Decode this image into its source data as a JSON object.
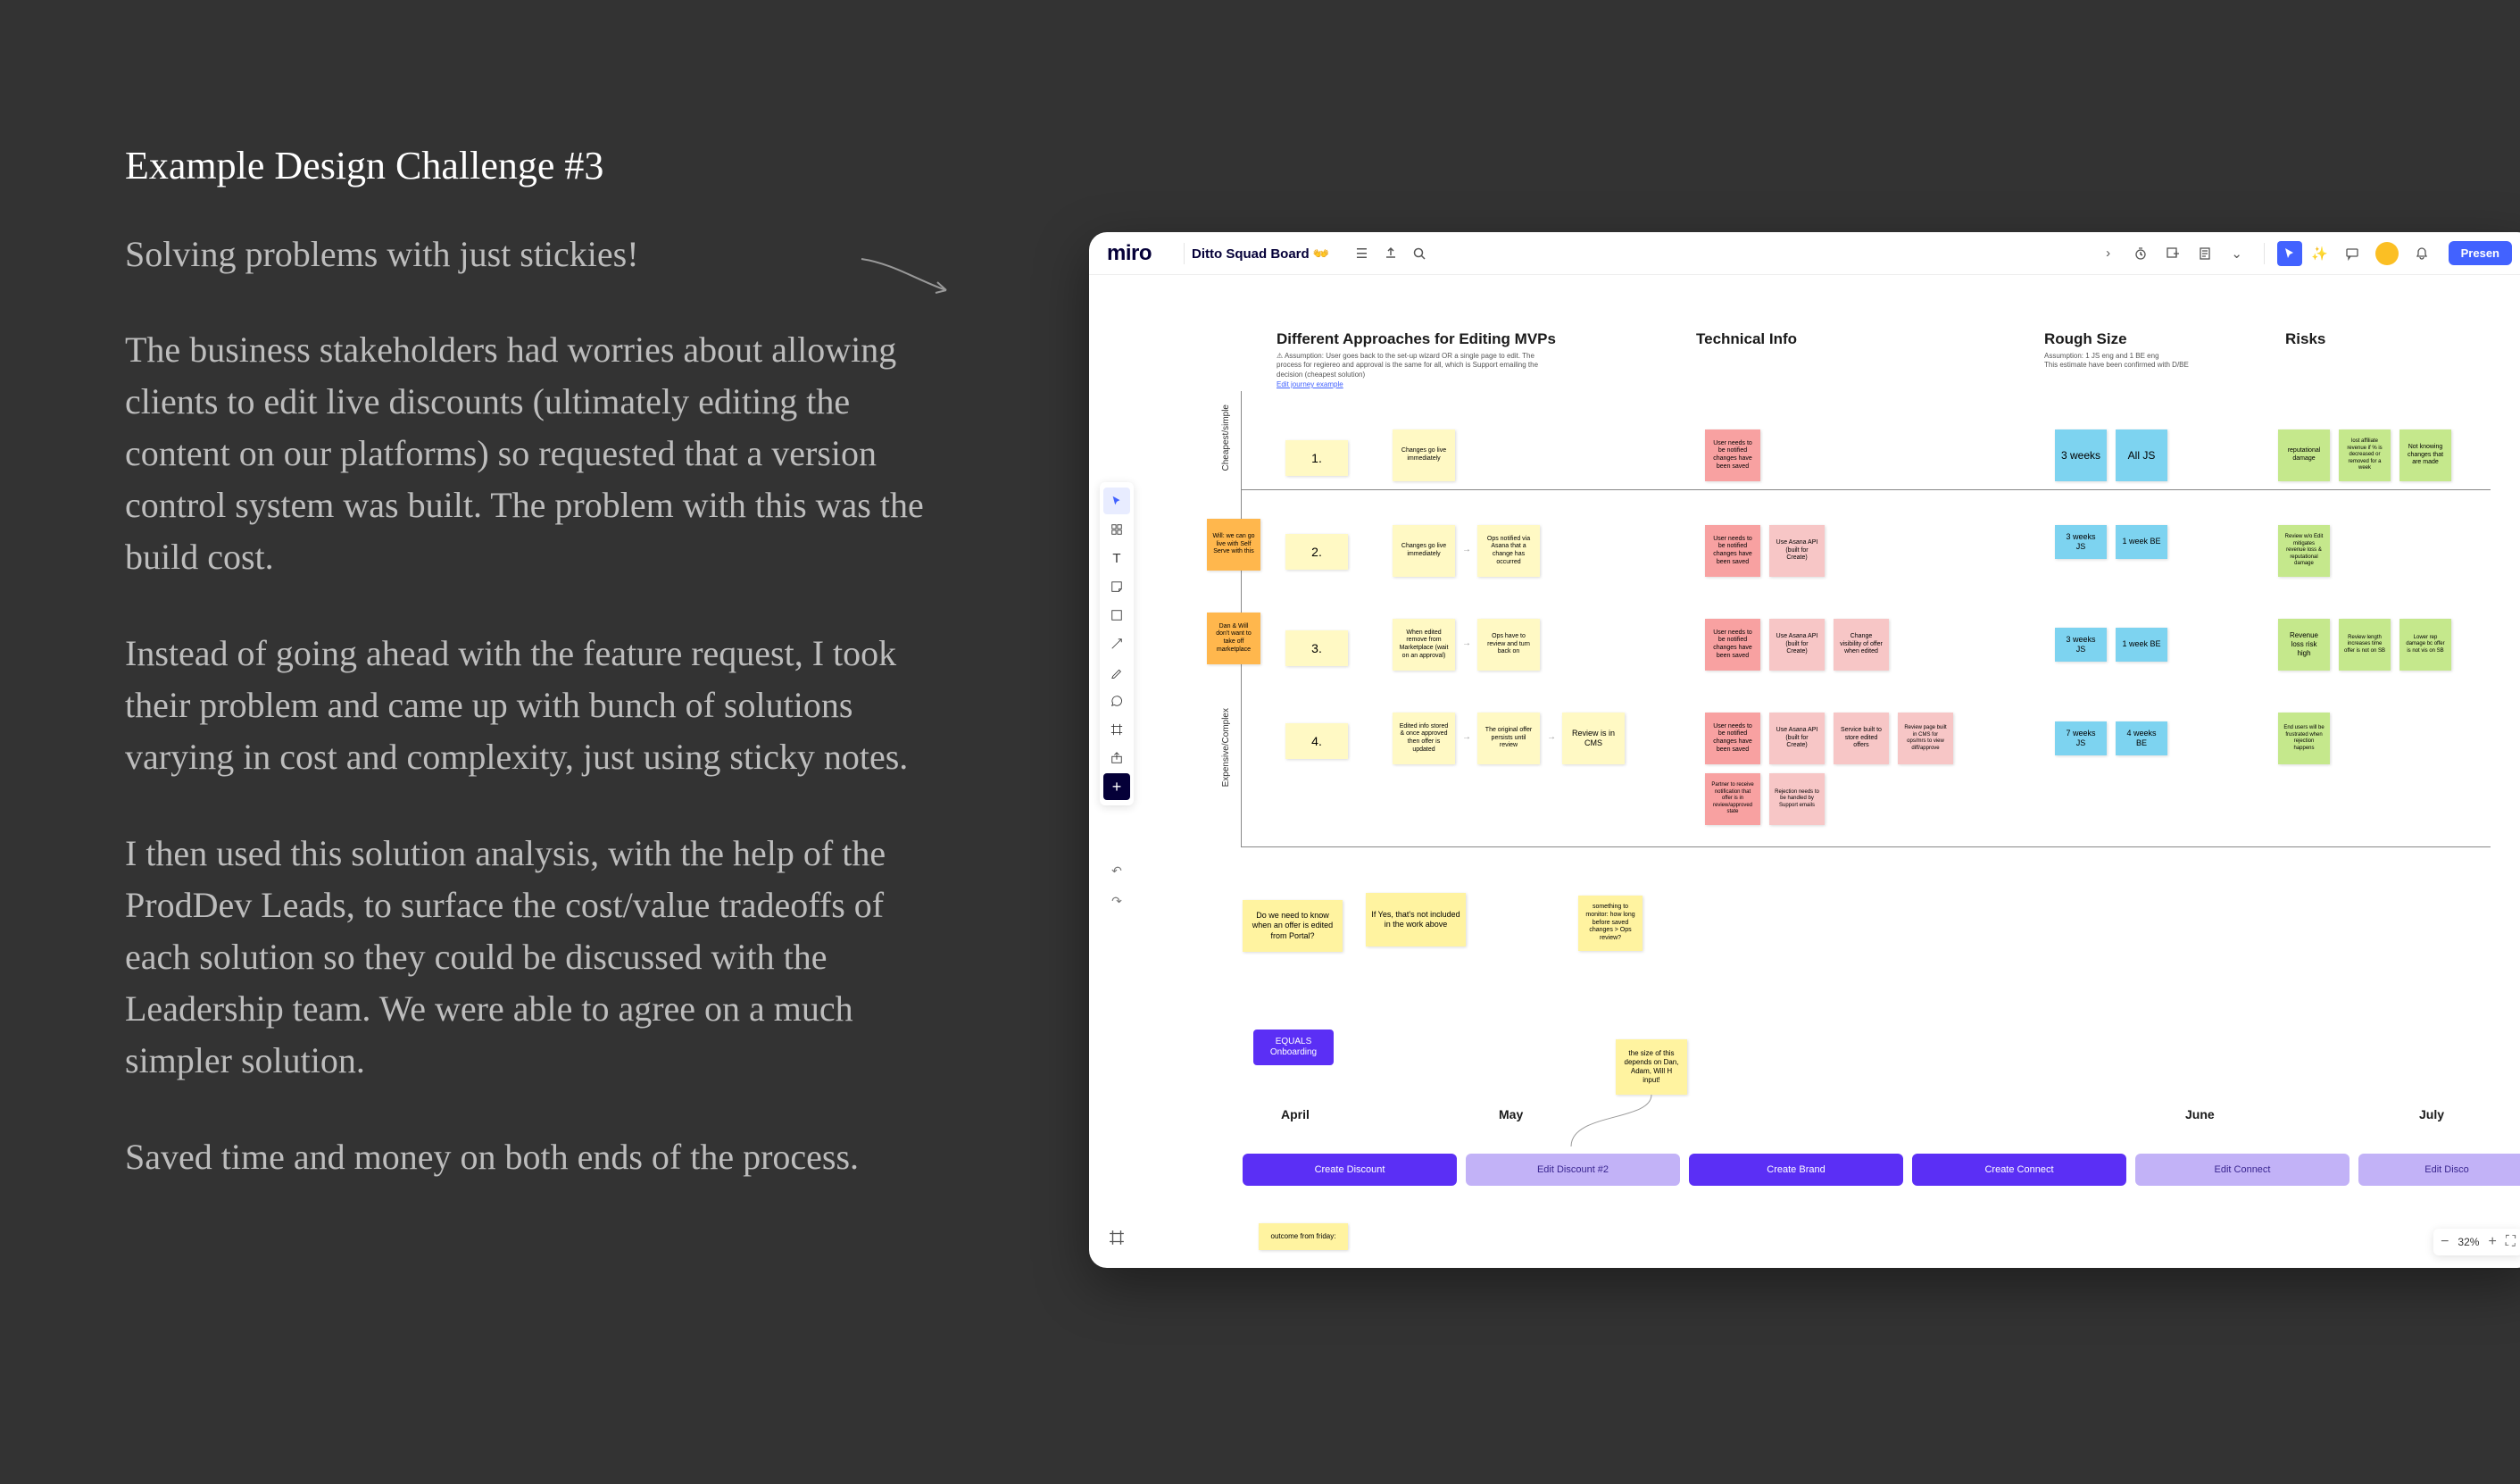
{
  "left": {
    "title": "Example Design Challenge #3",
    "subtitle": "Solving problems with just stickies!",
    "p1": "The business stakeholders had worries about allowing clients to edit live discounts (ultimately editing the content on our platforms) so requested that a version control system was built. The problem with this was the build cost.",
    "p2": "Instead of going ahead with the feature request, I took their problem and came up with bunch of solutions varying in cost and complexity, just using sticky notes.",
    "p3": "I then used this solution analysis, with the help of the ProdDev Leads, to surface the cost/value tradeoffs of each solution so they could be discussed with the Leadership team. We were able to agree on a much simpler solution.",
    "p4": "Saved time and money on both ends of the process."
  },
  "miro": {
    "logo": "miro",
    "board_title": "Ditto Squad Board 👐",
    "present": "Presen",
    "zoom_level": "32%",
    "headings": {
      "approaches": "Different Approaches for Editing MVPs",
      "tech": "Technical Info",
      "size": "Rough Size",
      "risks": "Risks"
    },
    "subnotes": {
      "assumption": "⚠ Assumption: User goes back to the set-up wizard OR a single page to edit. The process for regiereo and approval is the same for all, which is Support emailing the decision (cheapest solution)",
      "link": "Edit journey example",
      "size_note1": "Assumption: 1 JS eng and 1 BE eng",
      "size_note2": "This estimate have been confirmed with D/BE"
    },
    "axis": {
      "top": "Cheapest/simple",
      "bottom": "Expensive/Complex"
    },
    "rows": {
      "r1": "1.",
      "r2": "2.",
      "r3": "3.",
      "r4": "4."
    },
    "orange": {
      "o1": "Will: we can go live with Self Serve with this",
      "o2": "Dan & Will don't want to take off marketplace"
    },
    "yellow": {
      "r1a": "Changes go live immediately",
      "r2a": "Changes go live immediately",
      "r2b": "Ops notified via Asana that a change has occurred",
      "r3a": "When edited remove from Marketplace (wait on an approval)",
      "r3b": "Ops have to review and turn back on",
      "r4a": "Edited info stored & once approved then offer is updated",
      "r4b": "The original offer persists until review",
      "r4c": "Review is in CMS",
      "q1": "Do we need to know when an offer is edited from Portal?",
      "q2": "If Yes, that's not included in the work above",
      "q3": "something to monitor: how long before saved changes > Ops review?",
      "q4": "the size of this depends on Dan, Adam, Will H input!",
      "q5": "outcome from friday:"
    },
    "pink": {
      "t1": "User needs to be notified changes have been saved",
      "t2": "User needs to be notified changes have been saved",
      "t3": "Use Asana API (built for Create)",
      "t4": "User needs to be notified changes have been saved",
      "t5": "Use Asana API (built for Create)",
      "t6": "Change visibility of offer when edited",
      "t7": "User needs to be notified changes have been saved",
      "t8": "Use Asana API (built for Create)",
      "t9": "Service built to store edited offers",
      "t10": "Review page built in CMS for ops/mrs to view diff/approve",
      "t11": "Partner to receive notification that offer is in review/approved state",
      "t12": "Rejection needs to be handled by Support emails"
    },
    "blue": {
      "b1a": "3 weeks",
      "b1b": "All JS",
      "b2a": "3 weeks JS",
      "b2b": "1 week BE",
      "b3a": "3 weeks JS",
      "b3b": "1 week BE",
      "b4a": "7 weeks JS",
      "b4b": "4 weeks BE"
    },
    "green": {
      "g1a": "reputational damage",
      "g1b": "lost affiliate revenue if % is decreased or removed for a week",
      "g1c": "Not knowing changes that are made",
      "g2a": "Review w/o Edit mitigates revenue loss & reputational damage",
      "g3a": "Revenue loss risk high",
      "g3b": "Review length increases time offer is not on SB",
      "g3c": "Lower rep damage bc offer is not vis on SB",
      "g4a": "End users will be frustrated when rejection happens"
    },
    "tag": {
      "equals": "EQUALS Onboarding"
    },
    "months": {
      "apr": "April",
      "may": "May",
      "jun": "June",
      "jul": "July"
    },
    "bars": {
      "b1": "Create Discount",
      "b2": "Edit Discount #2",
      "b3": "Create Brand",
      "b4": "Create Connect",
      "b5": "Edit Connect",
      "b6": "Edit Disco"
    }
  }
}
